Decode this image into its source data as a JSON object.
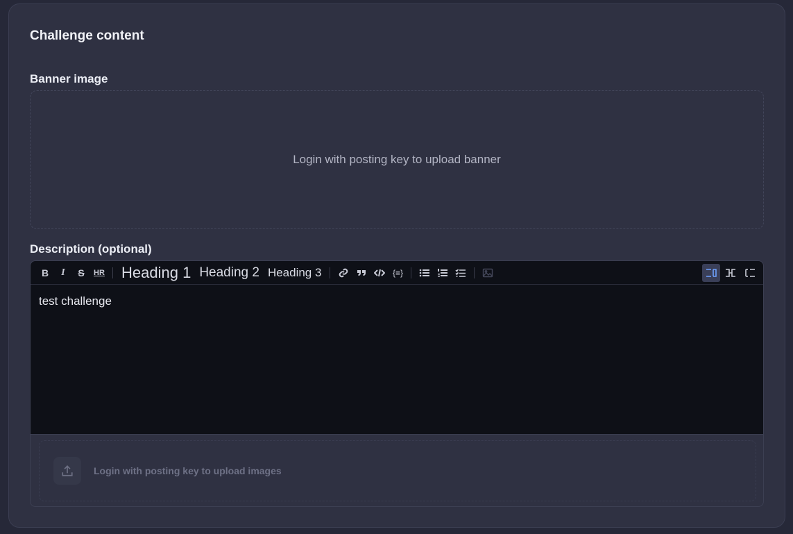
{
  "section": {
    "title": "Challenge content"
  },
  "banner": {
    "label": "Banner image",
    "placeholder_text": "Login with posting key to upload banner"
  },
  "description": {
    "label": "Description (optional)",
    "content": "test challenge",
    "toolbar": {
      "bold": "B",
      "italic": "I",
      "strike": "S",
      "hr": "HR",
      "heading1": "Heading 1",
      "heading2": "Heading 2",
      "heading3": "Heading 3",
      "code_block": "{≡}"
    },
    "upload_text": "Login with posting key to upload images"
  },
  "icons": {
    "link": "link-icon",
    "quote": "quote-icon",
    "code": "code-icon",
    "code_block": "code-block-icon",
    "bullet_list": "bullet-list-icon",
    "ordered_list": "ordered-list-icon",
    "task_list": "task-list-icon",
    "image": "image-icon",
    "view_editor": "editor-only-icon",
    "view_split": "split-view-icon",
    "view_preview": "preview-only-icon",
    "upload": "upload-icon"
  },
  "colors": {
    "card_bg": "#2f3142",
    "editor_bg": "#0e1017",
    "active_accent": "#6fa2ff"
  }
}
